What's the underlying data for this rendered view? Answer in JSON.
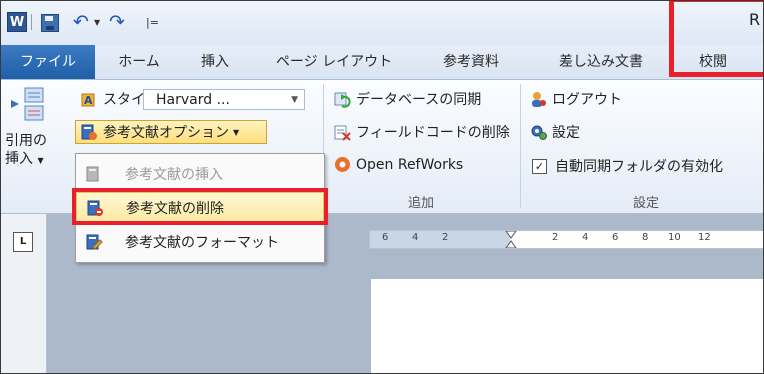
{
  "titlebar": {
    "word_icon": "W",
    "qa_menu": "|=",
    "title": "R"
  },
  "tabs": [
    "ファイル",
    "ホーム",
    "挿入",
    "ページ レイアウト",
    "参考資料",
    "差し込み文書",
    "校閲"
  ],
  "ribbon": {
    "citation_insert": [
      "引用の",
      "挿入"
    ],
    "style_label": "スタイル:",
    "style_value": "Harvard ...",
    "options_label": "参考文献オプション",
    "db_sync": "データベースの同期",
    "field_delete": "フィールドコードの削除",
    "open_refworks": "Open RefWorks",
    "group_add": "追加",
    "logout": "ログアウト",
    "settings": "設定",
    "auto_sync": "自動同期フォルダの有効化",
    "group_settings": "設定"
  },
  "dropdown": {
    "items": [
      {
        "label": "参考文献の挿入",
        "enabled": false
      },
      {
        "label": "参考文献の削除",
        "enabled": true,
        "highlighted": true
      },
      {
        "label": "参考文献のフォーマット",
        "enabled": true
      }
    ]
  },
  "ruler": {
    "ticks": [
      "6",
      "4",
      "2",
      "2",
      "4",
      "6",
      "8",
      "10",
      "12"
    ]
  },
  "colors": {
    "file_tab": "#1f5fa8",
    "highlight_red": "#e8202a",
    "hover_yellow": "#fde9a2"
  }
}
